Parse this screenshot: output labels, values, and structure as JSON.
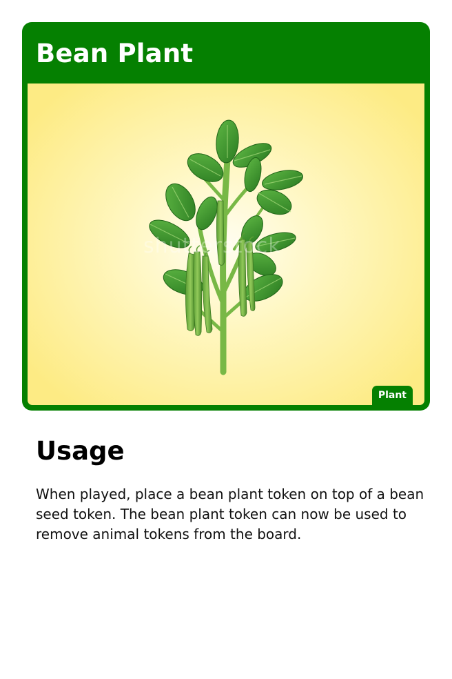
{
  "card": {
    "title": "Bean Plant",
    "type_badge": "Plant",
    "art_icon": "bean-plant-illustration",
    "watermark": "shutterstock",
    "colors": {
      "frame": "#058001",
      "art_background": "#fdeb84",
      "leaf": "#3f9a2f",
      "pod": "#7dbb45"
    }
  },
  "usage": {
    "heading": "Usage",
    "text": "When played, place a bean plant token on top of a bean seed token. The bean plant token can now be used to remove animal tokens from the board."
  }
}
